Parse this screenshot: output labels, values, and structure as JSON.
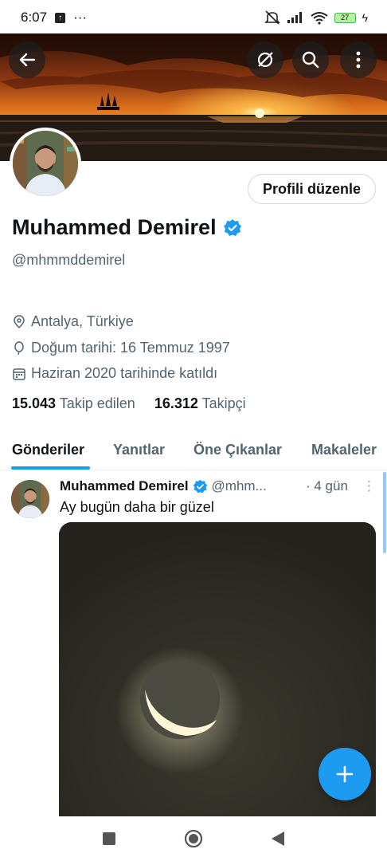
{
  "status_bar": {
    "time": "6:07",
    "battery": "27"
  },
  "header": {
    "back_icon": "arrow-left-icon",
    "actions": [
      "grok-icon",
      "search-icon",
      "more-vertical-icon"
    ]
  },
  "profile": {
    "name": "Muhammed Demirel",
    "handle": "@mhmmddemirel",
    "edit_label": "Profili düzenle",
    "location": "Antalya, Türkiye",
    "birthday": "Doğum tarihi: 16 Temmuz 1997",
    "joined": "Haziran 2020 tarihinde katıldı",
    "following_count": "15.043",
    "following_label": "Takip edilen",
    "followers_count": "16.312",
    "followers_label": "Takipçi",
    "verified_color": "#1d9bf0"
  },
  "tabs": [
    {
      "label": "Gönderiler",
      "active": true
    },
    {
      "label": "Yanıtlar",
      "active": false
    },
    {
      "label": "Öne Çıkanlar",
      "active": false
    },
    {
      "label": "Makaleler",
      "active": false
    }
  ],
  "post": {
    "author": "Muhammed Demirel",
    "handle": "@mhm...",
    "time": "· 4 gün",
    "more": "⋮",
    "text": "Ay bugün daha bir güzel"
  },
  "fab": {
    "icon": "plus-icon"
  },
  "nav": [
    "square-icon",
    "circle-home-icon",
    "triangle-back-icon"
  ],
  "colors": {
    "accent": "#1d9bf0",
    "muted": "#536471",
    "text": "#0f1419"
  }
}
